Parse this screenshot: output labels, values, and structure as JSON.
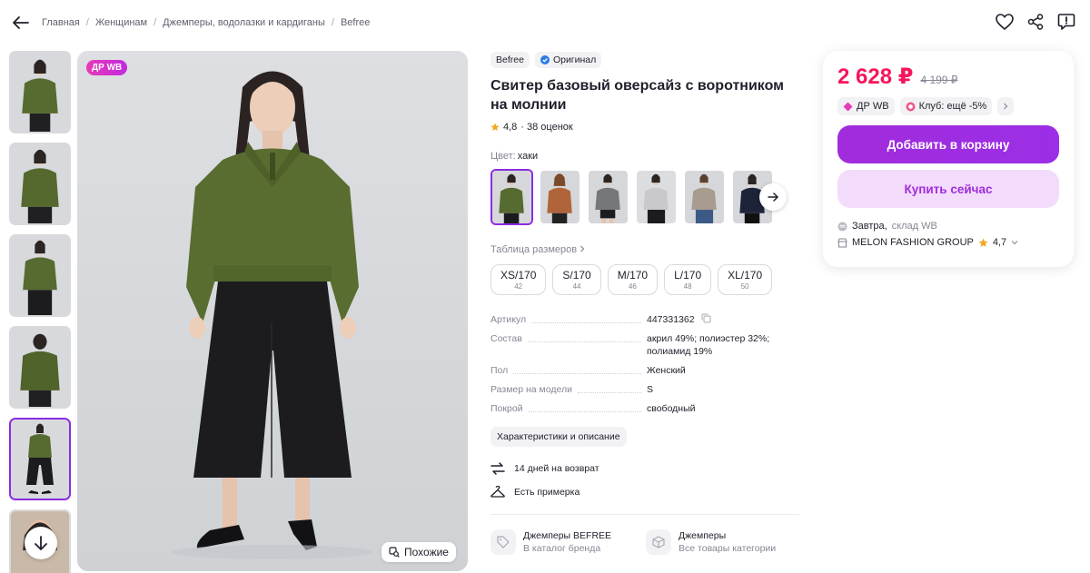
{
  "colors": {
    "accent": "#a12cdc",
    "price": "#f5175b",
    "muted": "#868695"
  },
  "header": {
    "breadcrumbs": [
      "Главная",
      "Женщинам",
      "Джемперы, водолазки и кардиганы",
      "Befree"
    ]
  },
  "gallery": {
    "badge": "ДР WB",
    "similar_label": "Похожие",
    "thumb_count": 6,
    "active_thumb": 5
  },
  "product": {
    "brand": "Befree",
    "original_label": "Оригинал",
    "title": "Свитер базовый оверсайз с воротником на молнии",
    "rating": "4,8",
    "reviews": "· 38 оценок",
    "color_label": "Цвет:",
    "color_value": "хаки",
    "size_table_label": "Таблица размеров",
    "sizes": [
      {
        "label": "XS/170",
        "ru": "42"
      },
      {
        "label": "S/170",
        "ru": "44"
      },
      {
        "label": "M/170",
        "ru": "46"
      },
      {
        "label": "L/170",
        "ru": "48"
      },
      {
        "label": "XL/170",
        "ru": "50"
      }
    ],
    "specs": [
      {
        "key": "Артикул",
        "value": "447331362"
      },
      {
        "key": "Состав",
        "value": "акрил 49%; полиэстер 32%; полиамид 19%"
      },
      {
        "key": "Пол",
        "value": "Женский"
      },
      {
        "key": "Размер на модели",
        "value": "S"
      },
      {
        "key": "Покрой",
        "value": "свободный"
      }
    ],
    "details_button": "Характеристики и описание",
    "return_text": "14 дней на возврат",
    "fitting_text": "Есть примерка",
    "categories": [
      {
        "title": "Джемперы BEFREE",
        "subtitle": "В каталог бренда"
      },
      {
        "title": "Джемперы",
        "subtitle": "Все товары категории"
      }
    ]
  },
  "buybox": {
    "price": "2 628 ₽",
    "old_price": "4 199 ₽",
    "tag_dr": "ДР WB",
    "tag_club": "Клуб: ещё -5%",
    "add_to_cart": "Добавить в корзину",
    "buy_now": "Купить сейчас",
    "delivery_day": "Завтра,",
    "delivery_source": "склад WB",
    "seller": "MELON FASHION GROUP",
    "seller_rating": "4,7"
  }
}
